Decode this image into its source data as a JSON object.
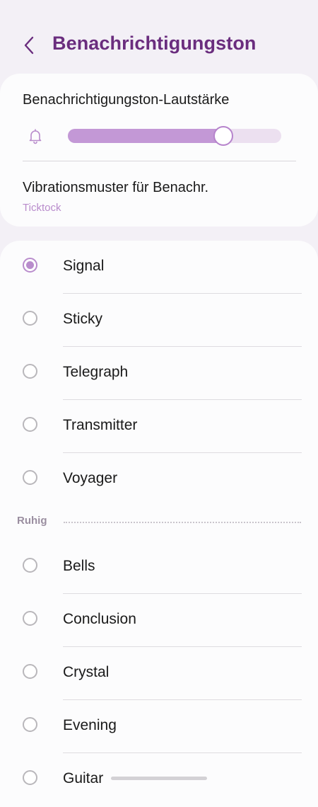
{
  "header": {
    "back_icon": "chevron-left-icon",
    "title": "Benachrichtigungston"
  },
  "volume": {
    "title": "Benachrichtigungston-Lautstärke",
    "icon": "bell-icon",
    "level": 0.73
  },
  "vibration": {
    "title": "Vibrationsmuster für Benachr.",
    "value": "Ticktock"
  },
  "sounds": {
    "items": [
      {
        "label": "Signal",
        "selected": true
      },
      {
        "label": "Sticky",
        "selected": false
      },
      {
        "label": "Telegraph",
        "selected": false
      },
      {
        "label": "Transmitter",
        "selected": false
      },
      {
        "label": "Voyager",
        "selected": false
      }
    ],
    "section_label": "Ruhig",
    "quiet_items": [
      {
        "label": "Bells",
        "selected": false
      },
      {
        "label": "Conclusion",
        "selected": false
      },
      {
        "label": "Crystal",
        "selected": false
      },
      {
        "label": "Evening",
        "selected": false
      },
      {
        "label": "Guitar",
        "selected": false
      }
    ]
  },
  "colors": {
    "title": "#6a2d7e",
    "accent": "#b98ccc",
    "slider_fill": "#c398d6",
    "slider_track": "#ece0f0",
    "background": "#f3f0f6"
  }
}
